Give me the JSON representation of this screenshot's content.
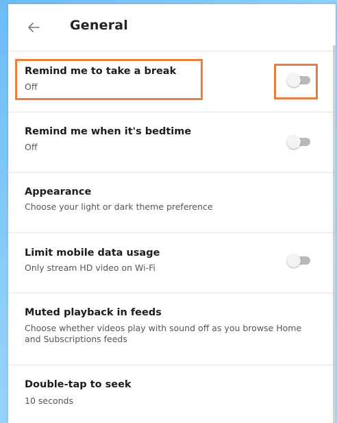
{
  "header": {
    "title": "General",
    "back_icon": "arrow-left-icon"
  },
  "settings": [
    {
      "title": "Remind me to take a break",
      "subtitle": "Off",
      "toggle": true,
      "on": false
    },
    {
      "title": "Remind me when it's bedtime",
      "subtitle": "Off",
      "toggle": true,
      "on": false
    },
    {
      "title": "Appearance",
      "subtitle": "Choose your light or dark theme preference",
      "toggle": false
    },
    {
      "title": "Limit mobile data usage",
      "subtitle": "Only stream HD video on Wi-Fi",
      "toggle": true,
      "on": false
    },
    {
      "title": "Muted playback in feeds",
      "subtitle": "Choose whether videos play with sound off as you browse Home and Subscriptions feeds",
      "toggle": false
    },
    {
      "title": "Double-tap to seek",
      "subtitle": "10 seconds",
      "toggle": false
    }
  ],
  "colors": {
    "highlight": "#e8803c",
    "toggle_track_off": "#b9b9b9",
    "toggle_knob_off": "#f3f3f3"
  }
}
